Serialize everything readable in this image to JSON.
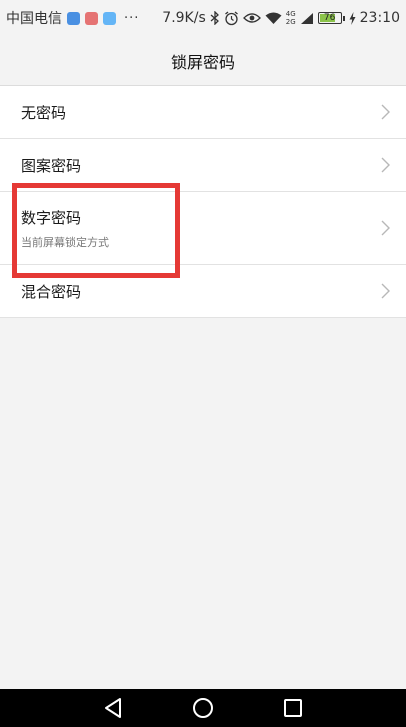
{
  "status_bar": {
    "carrier": "中国电信",
    "app_icons": [
      {
        "name": "download-app-icon",
        "color": "#4a90e2"
      },
      {
        "name": "lock-app-icon",
        "color": "#e57373"
      },
      {
        "name": "gallery-app-icon",
        "color": "#64b5f6"
      }
    ],
    "more_indicator": "···",
    "net_speed": "7.9K/s",
    "net_type_top": "4G",
    "net_type_bottom": "2G",
    "battery_level": "76",
    "battery_fraction": 0.76,
    "battery_color": "#8bc34a",
    "time": "23:10"
  },
  "header": {
    "title": "锁屏密码"
  },
  "options": [
    {
      "title": "无密码",
      "subtitle": ""
    },
    {
      "title": "图案密码",
      "subtitle": ""
    },
    {
      "title": "数字密码",
      "subtitle": "当前屏幕锁定方式"
    },
    {
      "title": "混合密码",
      "subtitle": ""
    }
  ],
  "colors": {
    "highlight": "#e53935",
    "background": "#f3f3f3",
    "list_background": "#ffffff"
  }
}
